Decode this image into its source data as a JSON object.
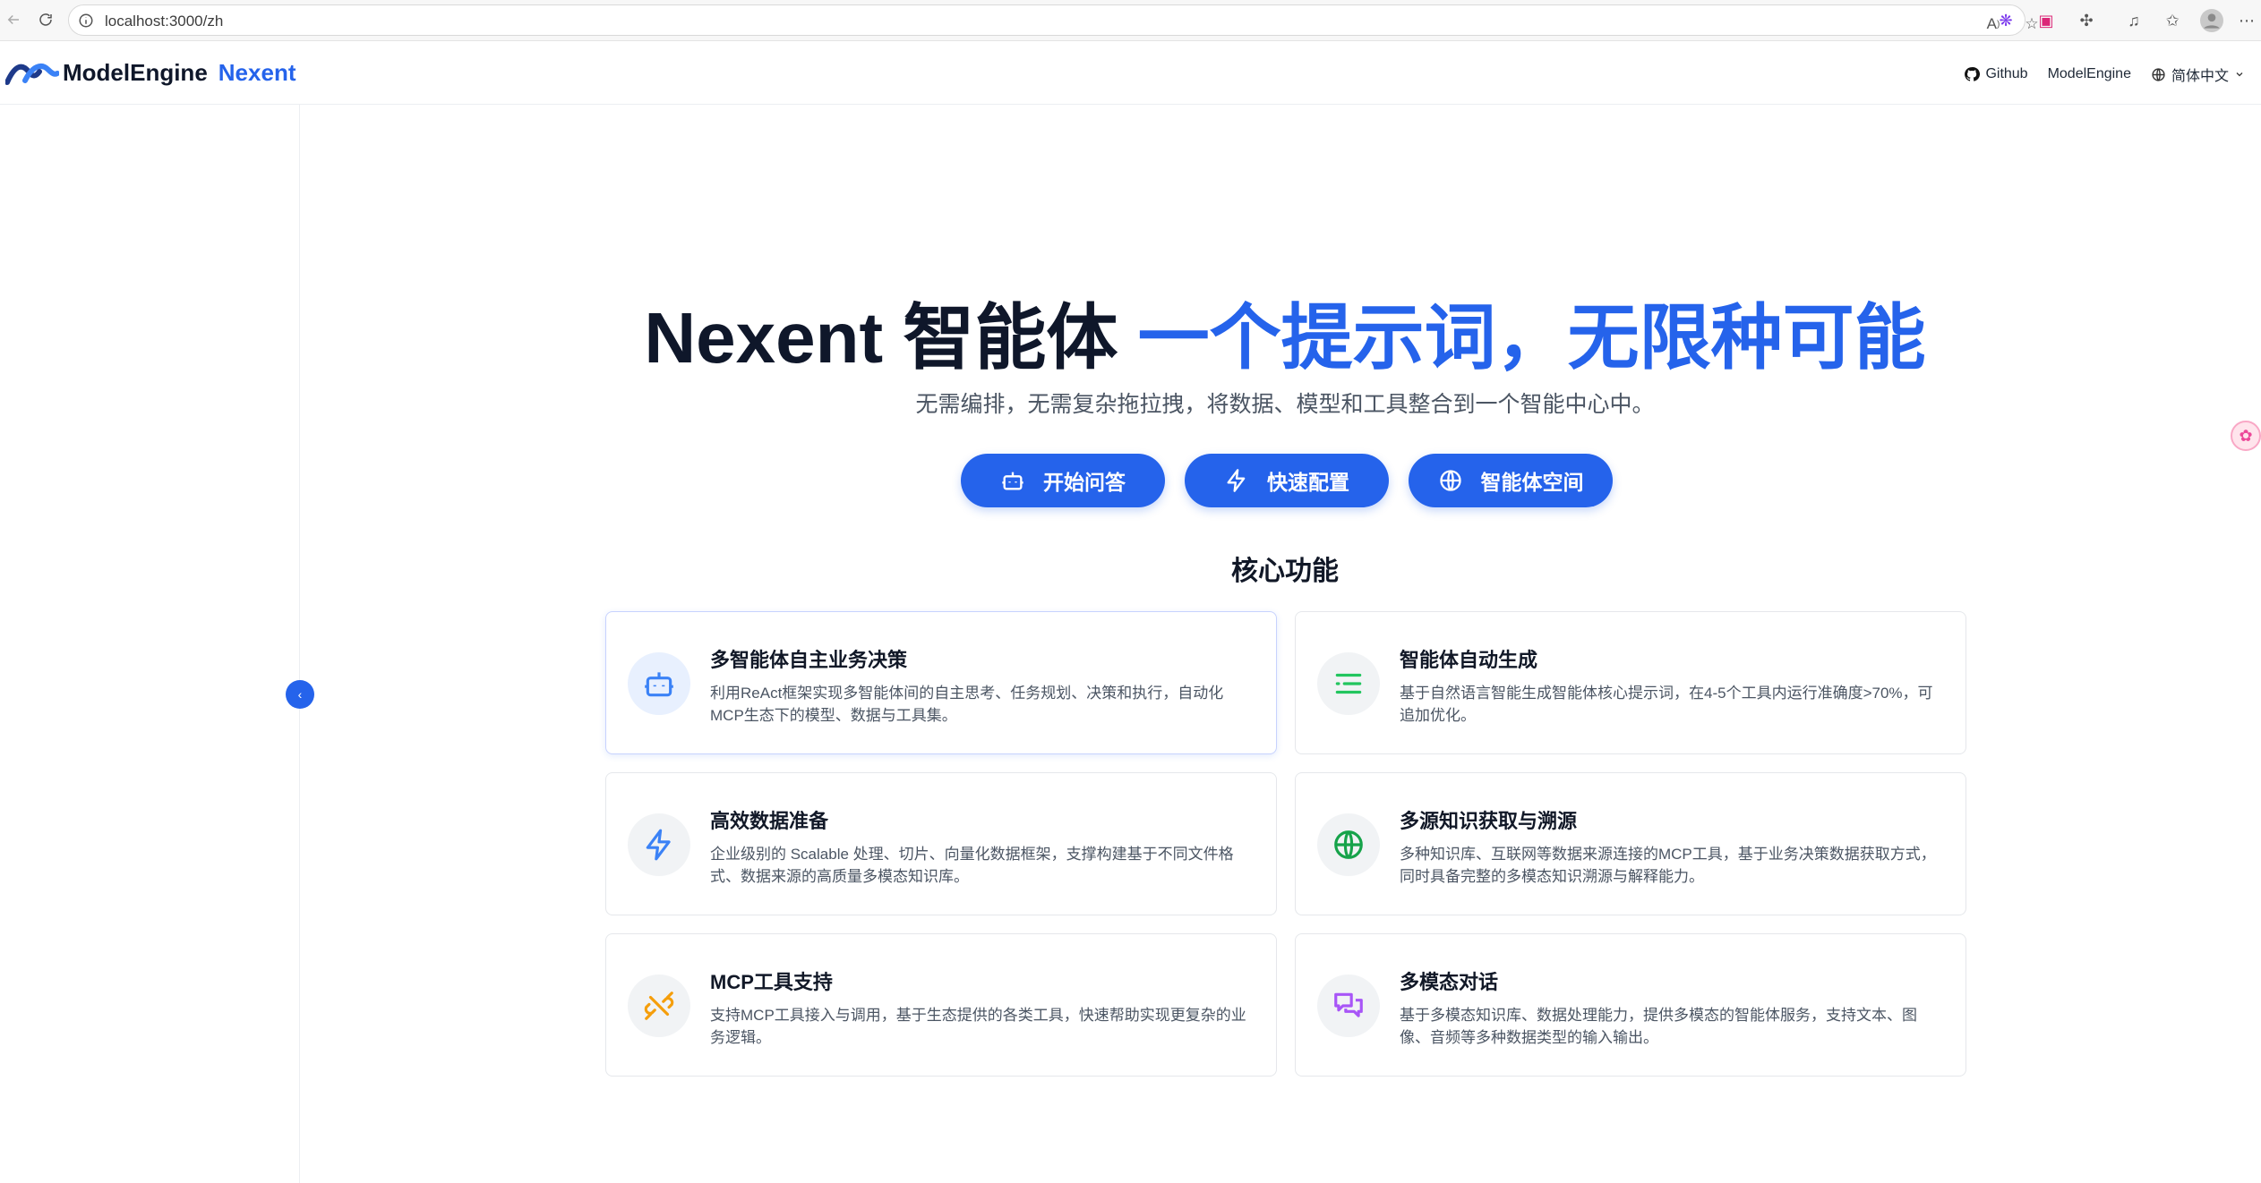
{
  "browser": {
    "url": "localhost:3000/zh"
  },
  "header": {
    "logo_part1": "ModelEngine",
    "logo_part2": "Nexent",
    "github_label": "Github",
    "modelengine_label": "ModelEngine",
    "language_label": "简体中文"
  },
  "hero": {
    "title_part1": "Nexent 智能体 ",
    "title_part2": "一个提示词，无限种可能",
    "subtitle": "无需编排，无需复杂拖拉拽，将数据、模型和工具整合到一个智能中心中。",
    "buttons": [
      {
        "label": "开始问答",
        "icon": "robot-icon"
      },
      {
        "label": "快速配置",
        "icon": "lightning-icon"
      },
      {
        "label": "智能体空间",
        "icon": "globe-icon"
      }
    ]
  },
  "features": {
    "title": "核心功能",
    "cards": [
      {
        "title": "多智能体自主业务决策",
        "desc": "利用ReAct框架实现多智能体间的自主思考、任务规划、决策和执行，自动化MCP生态下的模型、数据与工具集。",
        "icon": "robot-icon",
        "color": "#3b82f6"
      },
      {
        "title": "智能体自动生成",
        "desc": "基于自然语言智能生成智能体核心提示词，在4-5个工具内运行准确度>70%，可追加优化。",
        "icon": "list-icon",
        "color": "#22c55e"
      },
      {
        "title": "高效数据准备",
        "desc": "企业级别的 Scalable 处理、切片、向量化数据框架，支撑构建基于不同文件格式、数据来源的高质量多模态知识库。",
        "icon": "lightning-icon",
        "color": "#3b82f6"
      },
      {
        "title": "多源知识获取与溯源",
        "desc": "多种知识库、互联网等数据来源连接的MCP工具，基于业务决策数据获取方式，同时具备完整的多模态知识溯源与解释能力。",
        "icon": "globe-icon",
        "color": "#16a34a"
      },
      {
        "title": "MCP工具支持",
        "desc": "支持MCP工具接入与调用，基于生态提供的各类工具，快速帮助实现更复杂的业务逻辑。",
        "icon": "plug-icon",
        "color": "#f59e0b"
      },
      {
        "title": "多模态对话",
        "desc": "基于多模态知识库、数据处理能力，提供多模态的智能体服务，支持文本、图像、音频等多种数据类型的输入输出。",
        "icon": "chat-icon",
        "color": "#a855f7"
      }
    ]
  },
  "sidebar": {
    "collapse_symbol": "‹"
  }
}
